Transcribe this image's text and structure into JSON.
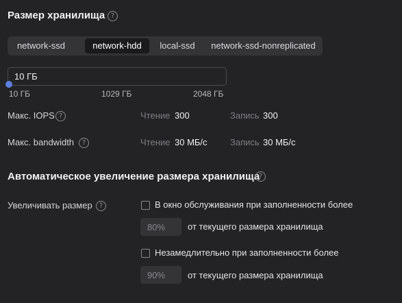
{
  "storage": {
    "title": "Размер хранилища",
    "help_icon": "question-circle-icon",
    "disk_types": [
      "network-ssd",
      "network-hdd",
      "local-ssd",
      "network-ssd-nonreplicated"
    ],
    "selected_disk_type": "network-hdd",
    "size_value": "10 ГБ",
    "slider": {
      "level_fraction": 0,
      "min_label": "10 ГБ",
      "mid_label": "1029 ГБ",
      "max_label": "2048 ГБ"
    },
    "iops": {
      "label": "Макс. IOPS",
      "read_label": "Чтение",
      "read_value": "300",
      "write_label": "Запись",
      "write_value": "300"
    },
    "bandwidth": {
      "label": "Макс. bandwidth",
      "read_label": "Чтение",
      "read_value": "30 МБ/с",
      "write_label": "Запись",
      "write_value": "30 МБ/с"
    }
  },
  "autoscale": {
    "title": "Автоматическое увеличение размера хранилища",
    "increase_label": "Увеличивать размер",
    "option1": {
      "checked": false,
      "label": "В окно обслуживания при заполненности более",
      "placeholder": "80%",
      "suffix": "от текущего размера хранилища"
    },
    "option2": {
      "checked": false,
      "label": "Незамедлительно при заполненности более",
      "placeholder": "90%",
      "suffix": "от текущего размера хранилища"
    }
  },
  "colors": {
    "background": "#232325",
    "accent": "#5a7fe0",
    "segmented_bg": "#343437",
    "segment_active": "#1a1a1c"
  }
}
